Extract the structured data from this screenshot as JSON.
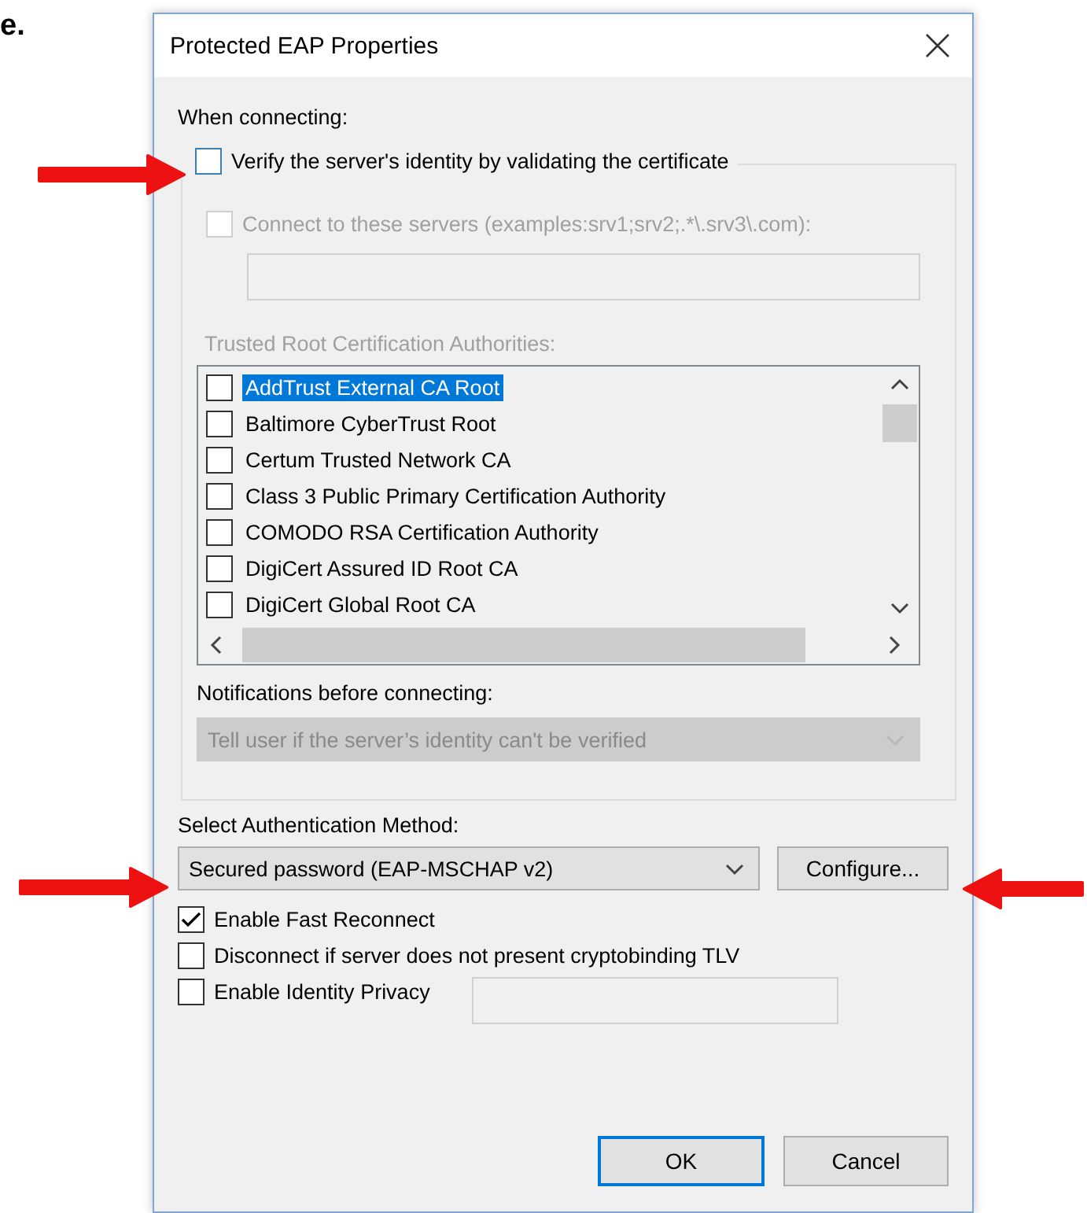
{
  "page_fragment": "e.",
  "window": {
    "title": "Protected EAP Properties"
  },
  "when_connecting": {
    "label": "When connecting:"
  },
  "verify_certificate": {
    "label": "Verify the server's identity by validating the certificate",
    "checked": false
  },
  "connect_servers": {
    "label": "Connect to these servers (examples:srv1;srv2;.*\\.srv3\\.com):",
    "checked": false,
    "disabled": true
  },
  "trusted_roots": {
    "label": "Trusted Root Certification Authorities:",
    "disabled": true,
    "items": [
      {
        "name": "AddTrust External CA Root",
        "checked": false,
        "selected": true
      },
      {
        "name": "Baltimore CyberTrust Root",
        "checked": false,
        "selected": false
      },
      {
        "name": "Certum Trusted Network CA",
        "checked": false,
        "selected": false
      },
      {
        "name": "Class 3 Public Primary Certification Authority",
        "checked": false,
        "selected": false
      },
      {
        "name": "COMODO RSA Certification Authority",
        "checked": false,
        "selected": false
      },
      {
        "name": "DigiCert Assured ID Root CA",
        "checked": false,
        "selected": false
      },
      {
        "name": "DigiCert Global Root CA",
        "checked": false,
        "selected": false
      }
    ]
  },
  "notifications": {
    "label": "Notifications before connecting:",
    "value": "Tell user if the server’s identity can't be verified",
    "disabled": true
  },
  "auth_method": {
    "label": "Select Authentication Method:",
    "value": "Secured password (EAP-MSCHAP v2)"
  },
  "configure_button": {
    "label": "Configure..."
  },
  "options": [
    {
      "label": "Enable Fast Reconnect",
      "checked": true
    },
    {
      "label": "Disconnect if server does not present cryptobinding TLV",
      "checked": false
    },
    {
      "label": "Enable Identity Privacy",
      "checked": false,
      "has_field": true
    }
  ],
  "buttons": [
    {
      "label": "OK",
      "default": true
    },
    {
      "label": "Cancel",
      "default": false
    }
  ]
}
